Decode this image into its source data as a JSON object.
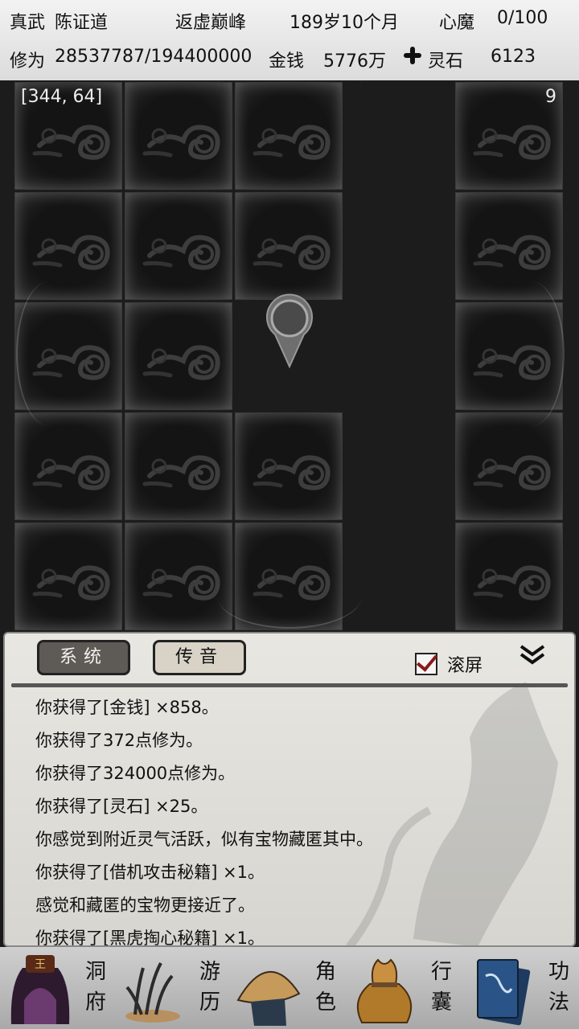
{
  "header": {
    "sect": "真武",
    "name": "陈证道",
    "realm": "返虚巅峰",
    "age": "189岁10个月",
    "demon_label": "心魔",
    "demon_value": "0/100",
    "cultivation_label": "修为",
    "cultivation_value": "28537787/194400000",
    "money_label": "金钱",
    "money_value": "5776万",
    "stone_icon": "cross-icon",
    "stone_label": "灵石",
    "stone_value": "6123"
  },
  "map": {
    "coord": "[344, 64]",
    "step_count": "9"
  },
  "panel": {
    "tabs": [
      "系统",
      "传音"
    ],
    "active_tab": 0,
    "scroll_label": "滚屏",
    "scroll_checked": true,
    "log": [
      "你获得了[金钱] ×858。",
      "你获得了372点修为。",
      "你获得了324000点修为。",
      "你获得了[灵石] ×25。",
      "你感觉到附近灵气活跃，似有宝物藏匿其中。",
      "你获得了[借机攻击秘籍] ×1。",
      "感觉和藏匿的宝物更接近了。",
      "你获得了[黑虎掏心秘籍] ×1。"
    ]
  },
  "nav": [
    {
      "icon": "cave-icon",
      "label_top": "洞",
      "label_bottom": "府"
    },
    {
      "icon": "herb-icon",
      "label_top": "游",
      "label_bottom": "历"
    },
    {
      "icon": "straw-hat-icon",
      "label_top": "角",
      "label_bottom": "色"
    },
    {
      "icon": "bag-icon",
      "label_top": "行",
      "label_bottom": "囊"
    },
    {
      "icon": "book-icon",
      "label_top": "功",
      "label_bottom": "法"
    }
  ]
}
